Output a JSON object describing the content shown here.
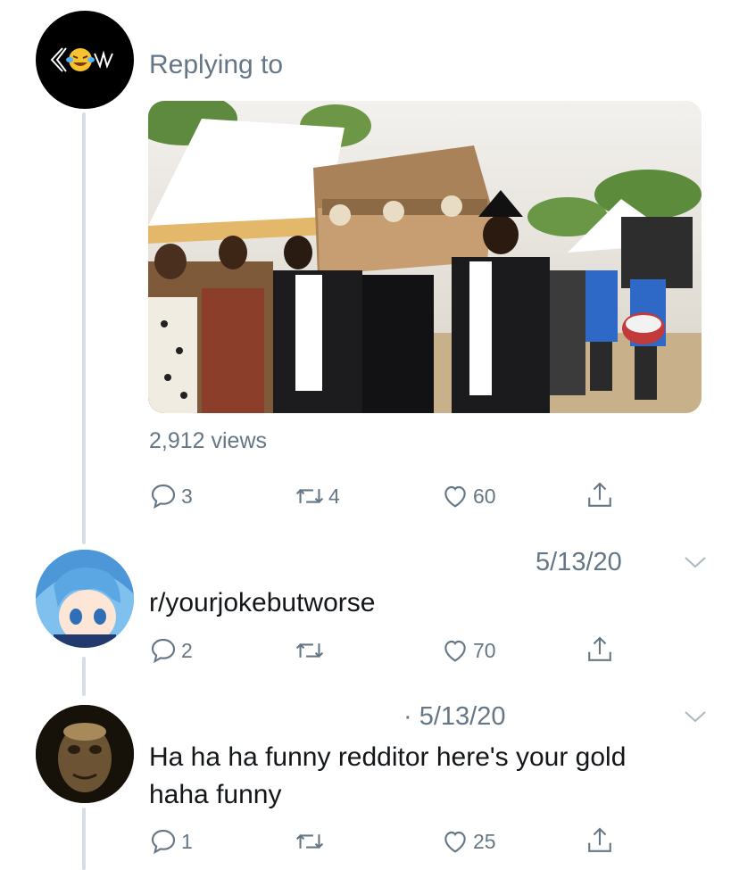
{
  "tweet_main": {
    "avatar_label": "reply avatar",
    "replying_to": "Replying to",
    "views": "2,912 views",
    "replies": "3",
    "retweets": "4",
    "likes": "60"
  },
  "tweet_reply_1": {
    "date": "5/13/20",
    "text": "r/yourjokebutworse",
    "replies": "2",
    "retweets": "",
    "likes": "70"
  },
  "tweet_reply_2": {
    "date": "· 5/13/20",
    "text_line1": "Ha ha ha funny redditor here's your gold",
    "text_line2": "haha funny",
    "replies": "1",
    "retweets": "",
    "likes": "25"
  },
  "colors": {
    "muted": "#657786",
    "thread_line": "#d7dde2"
  }
}
